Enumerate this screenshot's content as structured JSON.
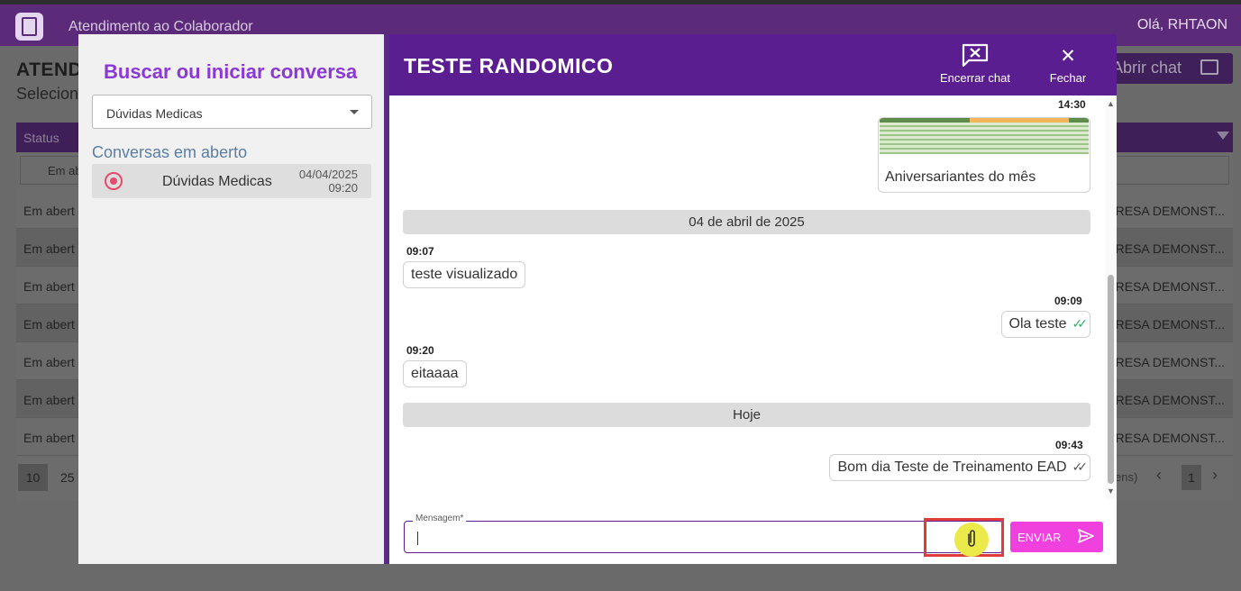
{
  "app": {
    "title": "Atendimento ao Colaborador",
    "greeting": "Olá, RHTAON"
  },
  "background": {
    "page_title": "ATEND",
    "page_subtitle": "Selecion",
    "open_chat_label": "Abrir chat",
    "grid_status_header": "Status",
    "filter_value": "Em ab",
    "rows": [
      {
        "status": "Em abert",
        "company": "RESA DEMONST..."
      },
      {
        "status": "Em abert",
        "company": "RESA DEMONST..."
      },
      {
        "status": "Em abert",
        "company": "RESA DEMONST..."
      },
      {
        "status": "Em abert",
        "company": "RESA DEMONST..."
      },
      {
        "status": "Em abert",
        "company": "RESA DEMONST..."
      },
      {
        "status": "Em abert",
        "company": "RESA DEMONST..."
      },
      {
        "status": "Em abert",
        "company": "RESA DEMONST..."
      }
    ],
    "pager": {
      "size_10": "10",
      "size_25": "25",
      "items_tail": "ens)",
      "page": "1"
    }
  },
  "left_panel": {
    "title": "Buscar ou iniciar conversa",
    "topic_selected": "Dúvidas Medicas",
    "open_conversations_label": "Conversas em aberto",
    "conversations": [
      {
        "name": "Dúvidas Medicas",
        "date": "04/04/2025",
        "time": "09:20"
      }
    ]
  },
  "chat": {
    "title": "TESTE RANDOMICO",
    "end_chat_label": "Encerrar chat",
    "close_label": "Fechar",
    "messages": {
      "m1_time": "14:30",
      "m1_caption": "Aniversariantes do mês",
      "sep1": "04 de abril de 2025",
      "m2_time": "09:07",
      "m2_text": "teste visualizado",
      "m3_time": "09:09",
      "m3_text": "Ola teste",
      "m4_time": "09:20",
      "m4_text": "eitaaaa",
      "sep2": "Hoje",
      "m5_time": "09:43",
      "m5_text": "Bom dia Teste de Treinamento EAD"
    },
    "input_label": "Mensagem*",
    "send_label": "ENVIAR"
  },
  "colors": {
    "header_purple": "#5b1e91",
    "title_purple": "#8a38d6",
    "send_pink": "#f040dd",
    "read_check": "#2db06b",
    "highlight_red": "#e23b3b"
  },
  "icons": [
    "app-logo-icon",
    "chat-icon",
    "filter-icon",
    "dropdown-caret-icon",
    "radio-icon",
    "end-chat-icon",
    "close-icon",
    "check-read-icon",
    "check-sent-icon",
    "attach-icon",
    "send-icon"
  ]
}
